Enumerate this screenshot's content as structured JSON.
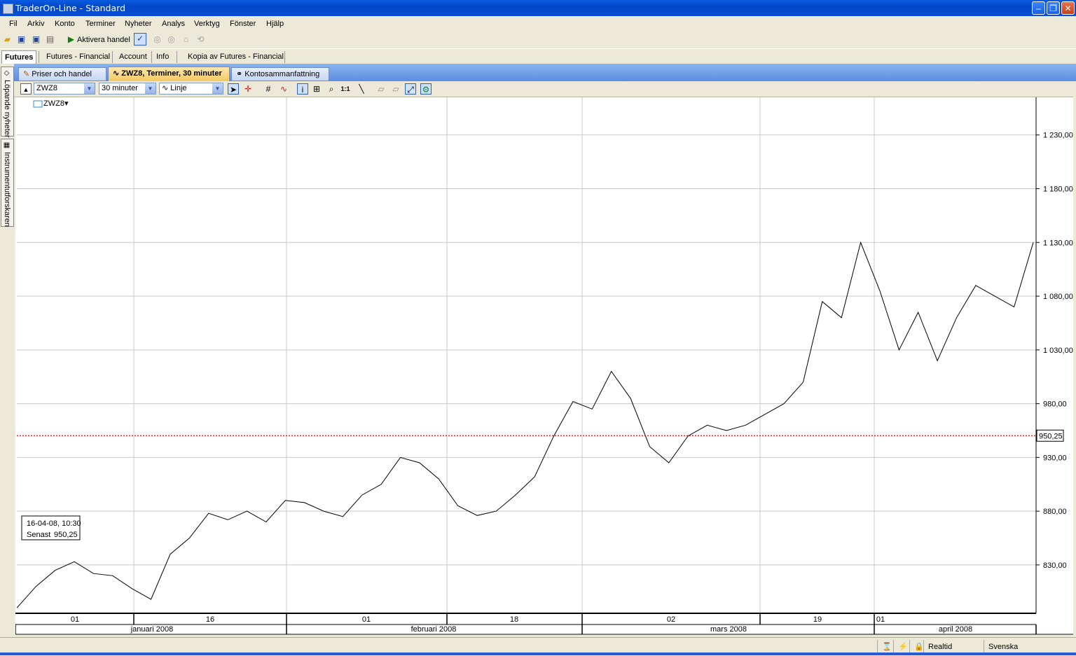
{
  "window": {
    "title": "TraderOn-Line - Standard"
  },
  "menu": [
    "Fil",
    "Arkiv",
    "Konto",
    "Terminer",
    "Nyheter",
    "Analys",
    "Verktyg",
    "Fönster",
    "Hjälp"
  ],
  "toolbar": {
    "activate_label": "Aktivera handel"
  },
  "main_tabs": [
    "Futures",
    "Futures - Financial",
    "Account",
    "Info",
    "Kopia av Futures - Financial"
  ],
  "doc_tabs": [
    "Priser och handel",
    "ZWZ8, Terminer, 30 minuter",
    "Kontosammanfattning"
  ],
  "side_tabs": [
    "Löpande nyheter",
    "Instrumentutforskaren"
  ],
  "chart_toolbar": {
    "instrument": "ZWZ8",
    "interval": "30 minuter",
    "chart_style": "Linje"
  },
  "chart_data": {
    "type": "line",
    "series": [
      {
        "name": "ZWZ8",
        "x": [
          "2008-01-01",
          "2008-01-03",
          "2008-01-05",
          "2008-01-07",
          "2008-01-09",
          "2008-01-11",
          "2008-01-13",
          "2008-01-15",
          "2008-01-17",
          "2008-01-19",
          "2008-01-21",
          "2008-01-23",
          "2008-01-25",
          "2008-01-27",
          "2008-01-29",
          "2008-01-31",
          "2008-02-02",
          "2008-02-04",
          "2008-02-06",
          "2008-02-08",
          "2008-02-10",
          "2008-02-12",
          "2008-02-14",
          "2008-02-16",
          "2008-02-18",
          "2008-02-20",
          "2008-02-22",
          "2008-02-24",
          "2008-02-26",
          "2008-02-28",
          "2008-03-01",
          "2008-03-03",
          "2008-03-05",
          "2008-03-07",
          "2008-03-09",
          "2008-03-11",
          "2008-03-13",
          "2008-03-15",
          "2008-03-17",
          "2008-03-19",
          "2008-03-21",
          "2008-03-23",
          "2008-03-25",
          "2008-03-27",
          "2008-03-29",
          "2008-03-31",
          "2008-04-02",
          "2008-04-04",
          "2008-04-06",
          "2008-04-08",
          "2008-04-10",
          "2008-04-12",
          "2008-04-14",
          "2008-04-16"
        ],
        "values": [
          790,
          810,
          825,
          833,
          822,
          820,
          808,
          798,
          840,
          855,
          878,
          872,
          880,
          870,
          890,
          888,
          880,
          875,
          895,
          905,
          930,
          925,
          910,
          885,
          876,
          880,
          895,
          912,
          950,
          982,
          975,
          1010,
          985,
          940,
          925,
          950,
          960,
          955,
          960,
          970,
          980,
          1000,
          1075,
          1060,
          1130,
          1085,
          1030,
          1065,
          1020,
          1060,
          1090,
          1080,
          1070,
          1130
        ]
      }
    ],
    "y_ticks": [
      "830,00",
      "880,00",
      "930,00",
      "980,00",
      "1 030,00",
      "1 080,00",
      "1 130,00",
      "1 180,00",
      "1 230,00"
    ],
    "ylim": [
      785,
      1265
    ],
    "last_value_label": "950,25",
    "day_labels": [
      "01",
      "16",
      "01",
      "18",
      "02",
      "19",
      "01"
    ],
    "month_labels": [
      "januari 2008",
      "februari 2008",
      "mars 2008",
      "april 2008"
    ],
    "legend": "ZWZ8",
    "grid": true
  },
  "info_box": {
    "date": "16-04-08, 10:30",
    "label": "Senast",
    "value": "950,25"
  },
  "status": {
    "mode": "Realtid",
    "language": "Svenska"
  },
  "colors": {
    "line": "#000000",
    "last_line": "#ff0000",
    "grid": "#c8c8c8"
  }
}
